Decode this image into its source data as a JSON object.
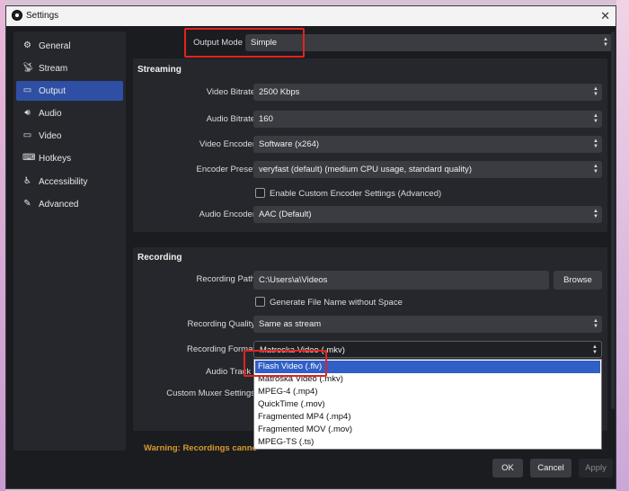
{
  "window": {
    "title": "Settings"
  },
  "sidebar": {
    "items": [
      {
        "label": "General",
        "icon": "gear-icon",
        "active": false
      },
      {
        "label": "Stream",
        "icon": "antenna-icon",
        "active": false
      },
      {
        "label": "Output",
        "icon": "monitor-output-icon",
        "active": true
      },
      {
        "label": "Audio",
        "icon": "speaker-icon",
        "active": false
      },
      {
        "label": "Video",
        "icon": "screen-icon",
        "active": false
      },
      {
        "label": "Hotkeys",
        "icon": "keyboard-icon",
        "active": false
      },
      {
        "label": "Accessibility",
        "icon": "accessibility-icon",
        "active": false
      },
      {
        "label": "Advanced",
        "icon": "wrench-icon",
        "active": false
      }
    ]
  },
  "output_mode": {
    "label": "Output Mode",
    "value": "Simple"
  },
  "streaming": {
    "title": "Streaming",
    "video_bitrate": {
      "label": "Video Bitrate",
      "value": "2500 Kbps"
    },
    "audio_bitrate": {
      "label": "Audio Bitrate",
      "value": "160"
    },
    "video_encoder": {
      "label": "Video Encoder",
      "value": "Software (x264)"
    },
    "encoder_preset": {
      "label": "Encoder Preset",
      "value": "veryfast (default) (medium CPU usage, standard quality)"
    },
    "custom_encoder": {
      "label": "Enable Custom Encoder Settings (Advanced)",
      "checked": false
    },
    "audio_encoder": {
      "label": "Audio Encoder",
      "value": "AAC (Default)"
    }
  },
  "recording": {
    "title": "Recording",
    "path": {
      "label": "Recording Path",
      "value": "C:\\Users\\a\\Videos",
      "browse": "Browse"
    },
    "no_space": {
      "label": "Generate File Name without Space",
      "checked": false
    },
    "quality": {
      "label": "Recording Quality",
      "value": "Same as stream"
    },
    "format": {
      "label": "Recording Format",
      "value": "Matroska Video (.mkv)",
      "options": [
        "Flash Video (.flv)",
        "Matroska Video (.mkv)",
        "MPEG-4 (.mp4)",
        "QuickTime (.mov)",
        "Fragmented MP4 (.mp4)",
        "Fragmented MOV (.mov)",
        "MPEG-TS (.ts)"
      ],
      "highlighted_option": "Flash Video (.flv)"
    },
    "audio_track": {
      "label": "Audio Track"
    },
    "custom_muxer": {
      "label": "Custom Muxer Settings"
    }
  },
  "warning": "Warning: Recordings canno",
  "buttons": {
    "ok": "OK",
    "cancel": "Cancel",
    "apply": "Apply"
  },
  "colors": {
    "accent": "#2f4fa5",
    "highlight_box": "#e3231f",
    "warning": "#d89a2b"
  }
}
